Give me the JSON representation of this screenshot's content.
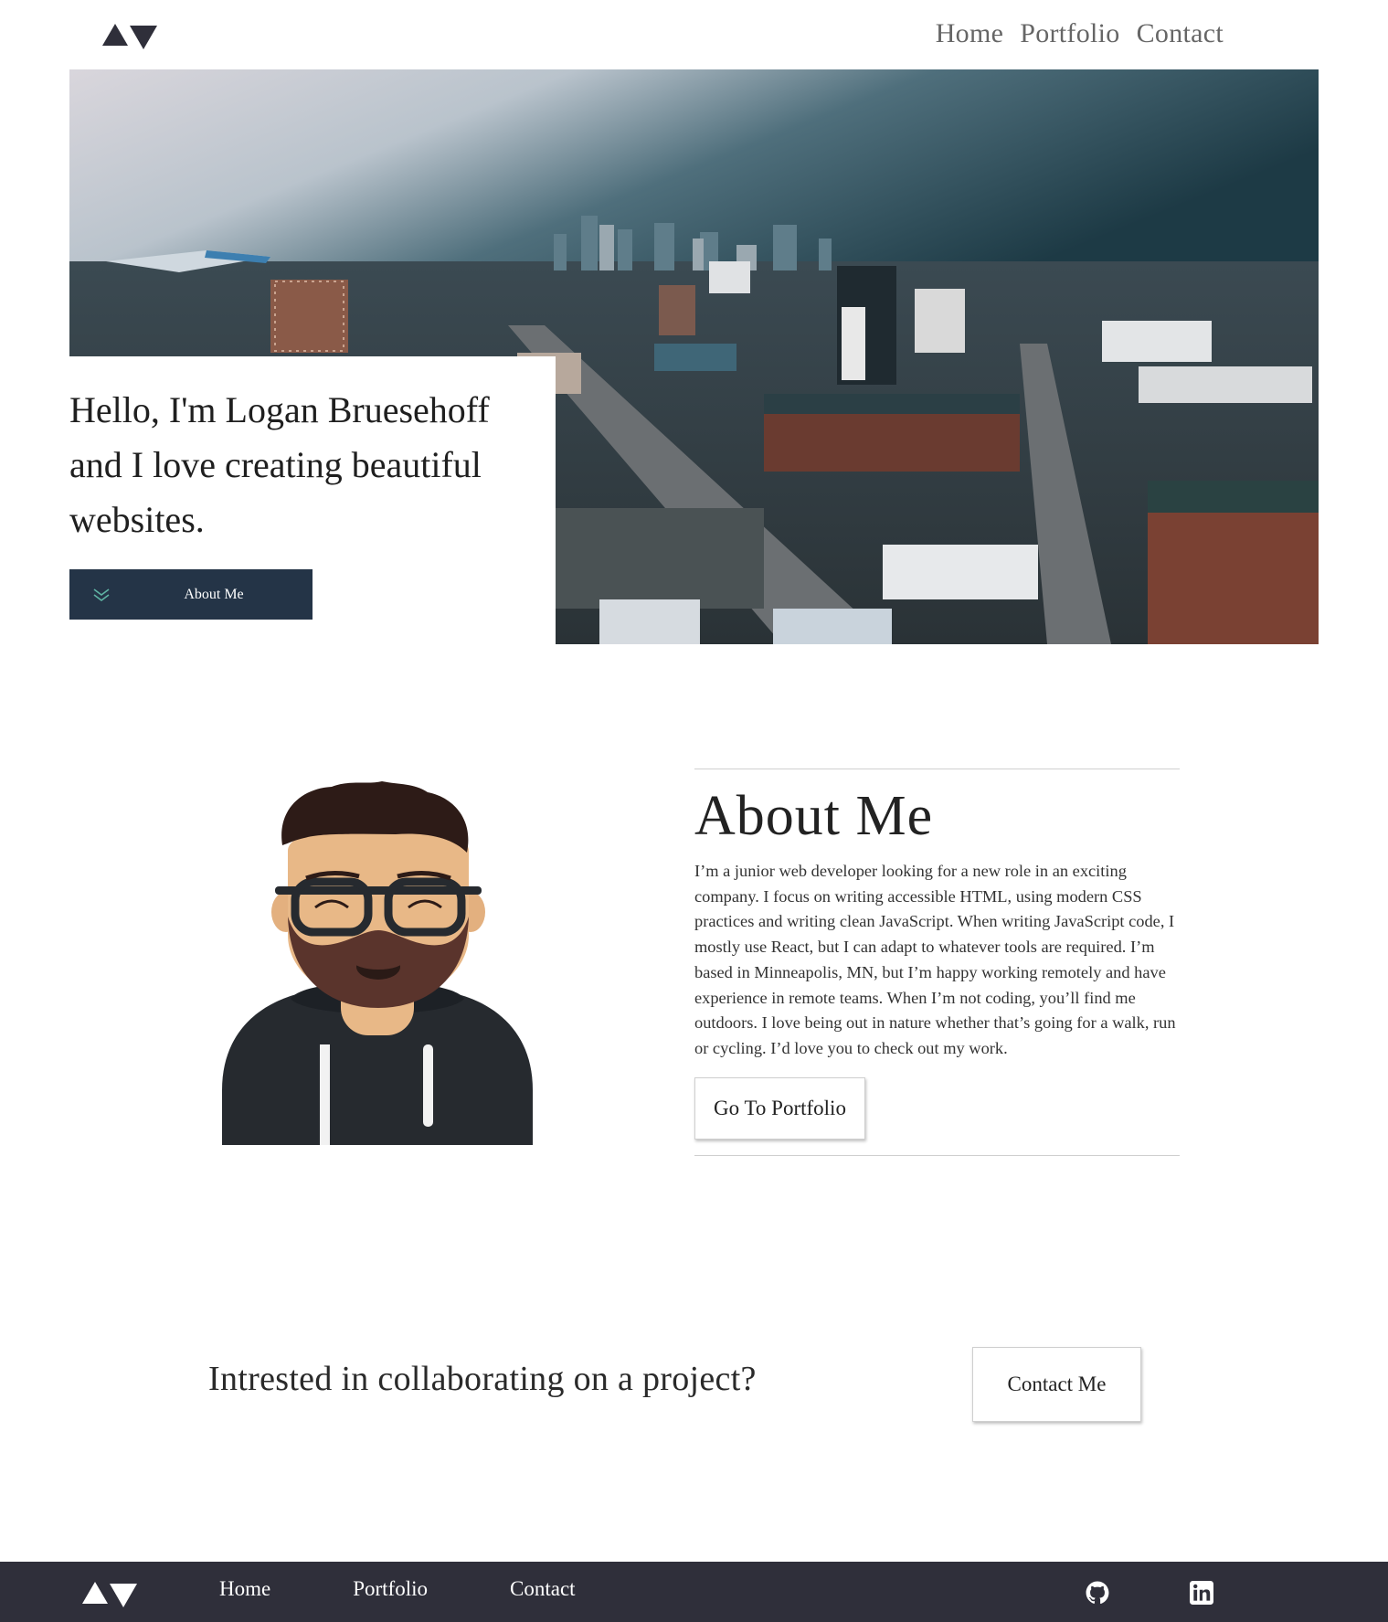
{
  "header": {
    "logo_icon": "triangles-logo-icon",
    "nav": [
      {
        "label": "Home"
      },
      {
        "label": "Portfolio"
      },
      {
        "label": "Contact"
      }
    ]
  },
  "hero": {
    "heading": "Hello, I'm Logan Bruesehoff and I love creating beautiful websites.",
    "button_label": "About Me",
    "button_icon": "double-chevron-down-icon",
    "image_icon": "city-skyline-photo"
  },
  "about": {
    "title": "About Me",
    "body": "I’m a junior web developer looking for a new role in an exciting company. I focus on writing accessible HTML, using modern CSS practices and writing clean JavaScript. When writing JavaScript code, I mostly use React, but I can adapt to whatever tools are required. I’m based in Minneapolis, MN, but I’m happy working remotely and have experience in remote teams. When I’m not coding, you’ll find me outdoors. I love being out in nature whether that’s going for a walk, run or cycling. I’d love you to check out my work.",
    "button_label": "Go To Portfolio",
    "avatar_icon": "avatar-illustration"
  },
  "cta": {
    "text": "Intrested in collaborating on a project?",
    "button_label": "Contact Me"
  },
  "footer": {
    "logo_icon": "triangles-logo-icon",
    "nav": [
      {
        "label": "Home"
      },
      {
        "label": "Portfolio"
      },
      {
        "label": "Contact"
      }
    ],
    "social": [
      "github-icon",
      "linkedin-icon"
    ]
  },
  "colors": {
    "primary_dark": "#243447",
    "footer_bg": "#2f2f3a",
    "nav_text": "#666666",
    "accent_teal": "#5fb4a4"
  }
}
